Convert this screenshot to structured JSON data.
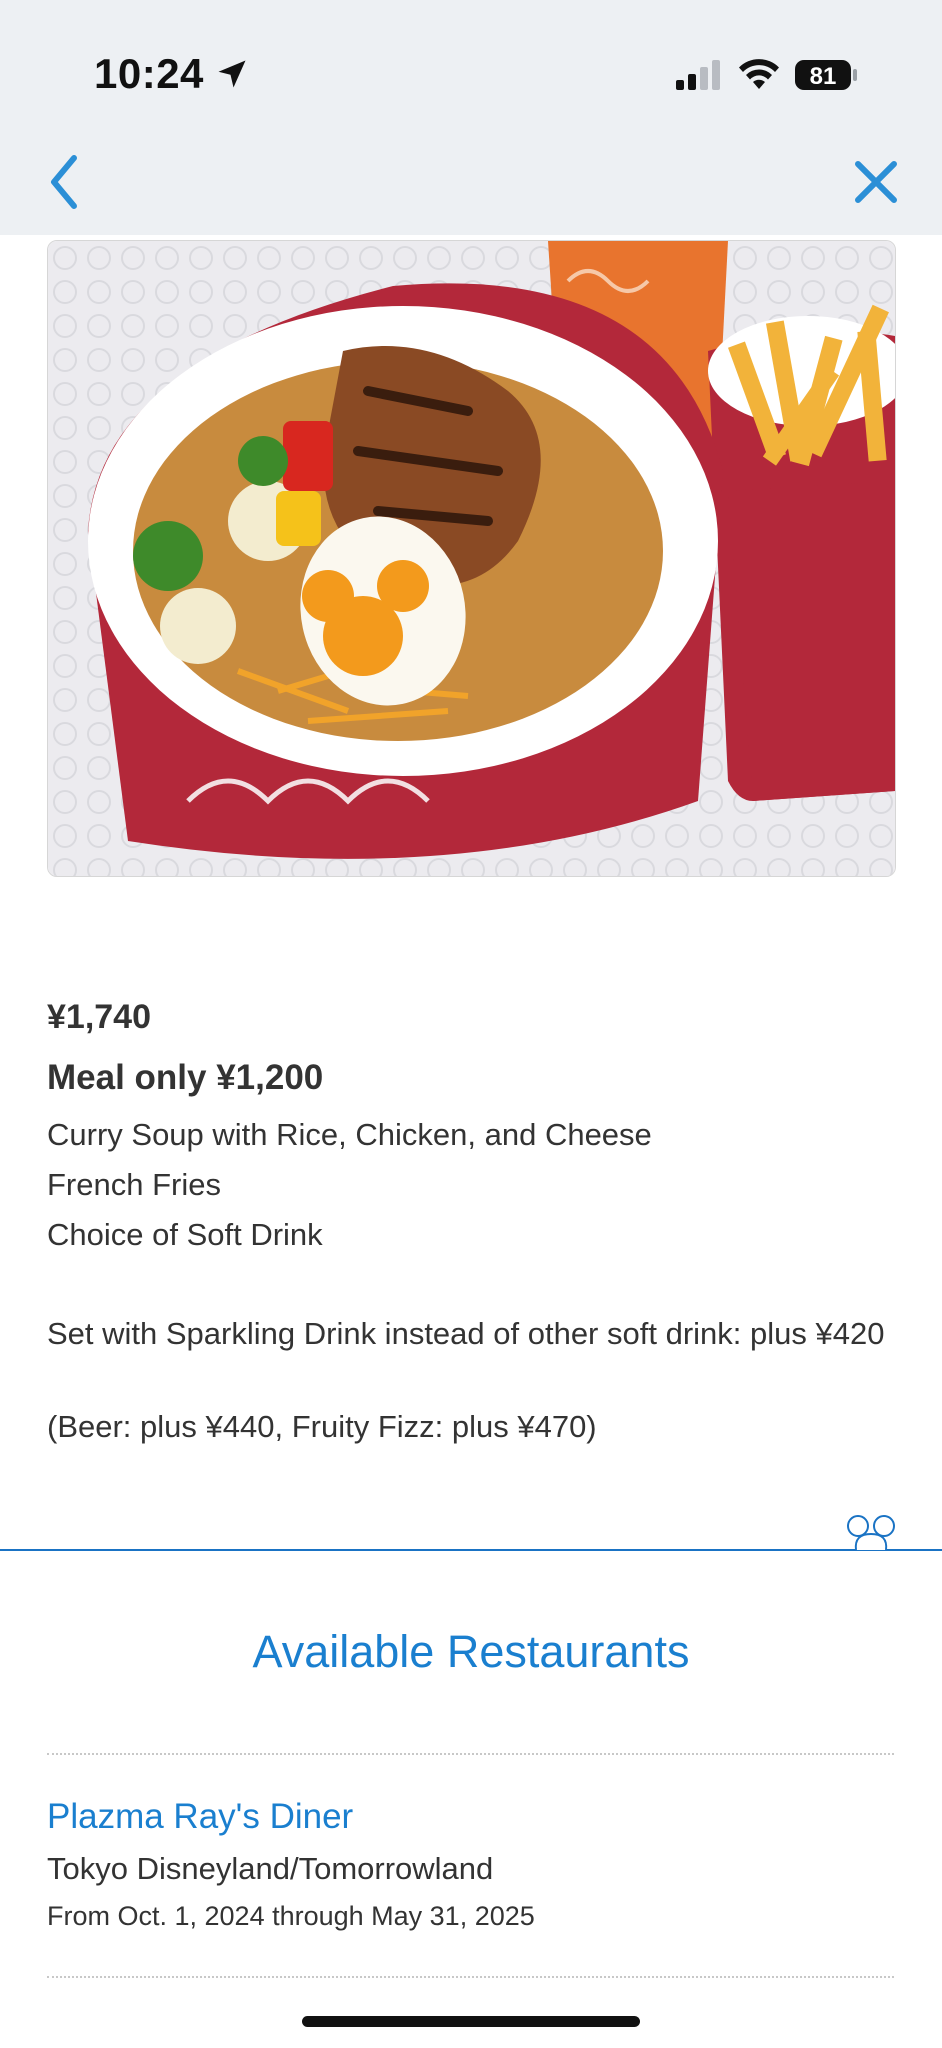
{
  "status_bar": {
    "time": "10:24",
    "battery": "81"
  },
  "nav": {
    "back_icon": "chevron-left-icon",
    "close_icon": "close-icon",
    "accent_color": "#2b8fd6"
  },
  "menu_item": {
    "price": "¥1,740",
    "meal_only": "Meal only ¥1,200",
    "items": [
      "Curry Soup with Rice, Chicken, and Cheese",
      "French Fries",
      "Choice of Soft Drink"
    ],
    "sparkling_note": "Set with Sparkling Drink instead of other soft drink: plus ¥420",
    "beer_note": "(Beer: plus ¥440, Fruity Fizz: plus ¥470)"
  },
  "available": {
    "title": "Available Restaurants",
    "restaurants": [
      {
        "name": "Plazma Ray's Diner",
        "location": "Tokyo Disneyland/Tomorrowland",
        "dates": "From Oct. 1, 2024 through May 31, 2025"
      }
    ]
  },
  "colors": {
    "link_blue": "#1a7fcf",
    "divider_blue": "#1a73c4",
    "status_bg": "#edf0f3"
  }
}
